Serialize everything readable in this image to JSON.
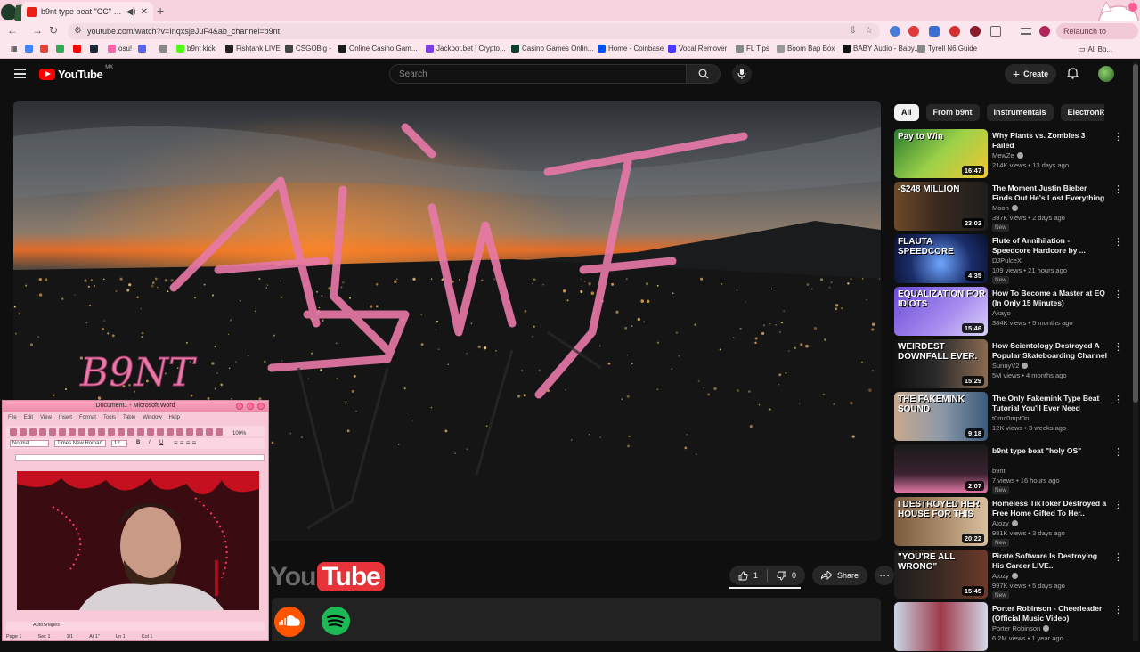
{
  "browser": {
    "tab_title": "b9nt type beat \"CC\" - YouTube",
    "url": "youtube.com/watch?v=InqxsjeJuF4&ab_channel=b9nt",
    "relaunch_label": "Relaunch to",
    "bookmarks": [
      {
        "label": "",
        "color": "#4285f4"
      },
      {
        "label": "",
        "color": "#ea4335"
      },
      {
        "label": "",
        "color": "#34a853"
      },
      {
        "label": "",
        "color": "#ff0000"
      },
      {
        "label": "",
        "color": "#1b2838"
      },
      {
        "label": "osu!",
        "color": "#ff66aa"
      },
      {
        "label": "",
        "color": "#5865f2"
      },
      {
        "label": "",
        "color": "#888888"
      },
      {
        "label": "b9nt kick",
        "color": "#53fc18"
      },
      {
        "label": "Fishtank LIVE",
        "color": "#222222"
      },
      {
        "label": "CSGOBig -",
        "color": "#444444"
      },
      {
        "label": "Online Casino Gam...",
        "color": "#1a1a1a"
      },
      {
        "label": "Jackpot.bet | Crypto...",
        "color": "#7b3fe4"
      },
      {
        "label": "Casino Games Onlin...",
        "color": "#0f3d2e"
      },
      {
        "label": "Home - Coinbase",
        "color": "#0052ff"
      },
      {
        "label": "Vocal Remover",
        "color": "#4a3aff"
      },
      {
        "label": "FL Tips",
        "color": "#888888"
      },
      {
        "label": "Boom Bap Box",
        "color": "#999999"
      },
      {
        "label": "BABY Audio - Baby...",
        "color": "#111111"
      },
      {
        "label": "Tyrell N6 Guide",
        "color": "#888888"
      }
    ],
    "all_bookmarks_label": "All Bo..."
  },
  "youtube": {
    "logo_text": "YouTube",
    "region_code": "MX",
    "search_placeholder": "Search",
    "create_label": "Create",
    "like_count": "1",
    "dislike_count": "0",
    "share_label": "Share",
    "chips": [
      "All",
      "From b9nt",
      "Instrumentals",
      "Electronic"
    ],
    "recommendations": [
      {
        "title": "Why Plants vs. Zombies 3 Failed",
        "channel": "MewZe",
        "verified": true,
        "meta": "214K views • 13 days ago",
        "badge": "",
        "duration": "16:47",
        "thumb_text": "Pay to Win",
        "thumb_bg": "linear-gradient(135deg,#2b7a2f,#9bd14a 50%,#f3c630)"
      },
      {
        "title": "The Moment Justin Bieber Finds Out He's Lost Everything",
        "channel": "Moon",
        "verified": true,
        "meta": "397K views • 2 days ago",
        "badge": "New",
        "duration": "23:02",
        "thumb_text": "-$248 MILLION",
        "thumb_bg": "linear-gradient(90deg,#6d4a2a,#3b2a1e 45%,#1d1d1d)"
      },
      {
        "title": "Flute of Annihilation - Speedcore Hardcore by ...",
        "channel": "DJPulceX",
        "verified": false,
        "meta": "109 views • 21 hours ago",
        "badge": "New",
        "duration": "4:35",
        "thumb_text": "FLAUTA SPEEDCORE",
        "thumb_bg": "radial-gradient(circle at 50% 60%,#6fa6ff,#1b2e6b 55%,#0b0f2a)"
      },
      {
        "title": "How To Become a Master at EQ (In Only 15 Minutes)",
        "channel": "Akayo",
        "verified": false,
        "meta": "384K views • 5 months ago",
        "badge": "",
        "duration": "15:46",
        "thumb_text": "EQUALIZATION FOR IDIOTS",
        "thumb_bg": "linear-gradient(135deg,#6b4bd6,#a98ef0 60%,#d9d3f7)"
      },
      {
        "title": "How Scientology Destroyed A Popular Skateboarding Channel",
        "channel": "SunnyV2",
        "verified": true,
        "meta": "5M views • 4 months ago",
        "badge": "",
        "duration": "15:29",
        "thumb_text": "WEIRDEST DOWNFALL EVER.",
        "thumb_bg": "linear-gradient(90deg,#111,#2a2a2a 45%,#8a6b52)"
      },
      {
        "title": "The Only Fakemink Type Beat Tutorial You'll Ever Need",
        "channel": "t0mc0mpt0n",
        "verified": false,
        "meta": "12K views • 3 weeks ago",
        "badge": "",
        "duration": "9:18",
        "thumb_text": "THE FAKEMINK SOUND",
        "thumb_bg": "linear-gradient(90deg,#c9a98e,#8d99a8 50%,#3c5a7a)"
      },
      {
        "title": "b9nt type beat \"holy OS\"",
        "channel": "b9nt",
        "verified": false,
        "meta": "7 views • 16 hours ago",
        "badge": "New",
        "duration": "2:07",
        "thumb_text": "",
        "thumb_bg": "linear-gradient(180deg,#1a1a1a,#3a2230 60%,#e879a8)"
      },
      {
        "title": "Homeless TikToker Destroyed a Free Home Gifted To Her..",
        "channel": "Atozy",
        "verified": true,
        "meta": "981K views • 3 days ago",
        "badge": "New",
        "duration": "20:22",
        "thumb_text": "I DESTROYED HER HOUSE FOR THIS",
        "thumb_bg": "linear-gradient(90deg,#7a5a3c,#a88a6a 50%,#d9c0a0)"
      },
      {
        "title": "Pirate Software Is Destroying His Career LIVE..",
        "channel": "Atozy",
        "verified": true,
        "meta": "997K views • 5 days ago",
        "badge": "New",
        "duration": "15:45",
        "thumb_text": "\"YOU'RE ALL WRONG\"",
        "thumb_bg": "linear-gradient(90deg,#1d1d1d,#3b2a22 50%,#6d3a2a)"
      },
      {
        "title": "Porter Robinson - Cheerleader (Official Music Video)",
        "channel": "Porter Robinson",
        "verified": true,
        "meta": "6.2M views • 1 year ago",
        "badge": "",
        "duration": "",
        "thumb_text": "",
        "thumb_bg": "linear-gradient(90deg,#c9d6e6,#9e3a4a 50%,#d2d8e8)"
      }
    ]
  },
  "overlay": {
    "video_logo_text": "B9NT",
    "wordmark_you": "You",
    "wordmark_tube": "Tube",
    "word_title": "Document1 - Microsoft Word",
    "word_menu": [
      "File",
      "Edit",
      "View",
      "Insert",
      "Format",
      "Tools",
      "Table",
      "Window",
      "Help"
    ],
    "word_style": "Normal",
    "word_font": "Times New Roman",
    "word_size": "12",
    "word_zoom": "100%",
    "word_drawing": "AutoShapes",
    "word_status": [
      "Page 1",
      "Sec 1",
      "1/1",
      "At 1\"",
      "Ln 1",
      "Col 1"
    ]
  },
  "colors": {
    "brand_red": "#ff0000",
    "pink_logo": "#e879a8",
    "chrome_pink": "#fbe6ee"
  }
}
